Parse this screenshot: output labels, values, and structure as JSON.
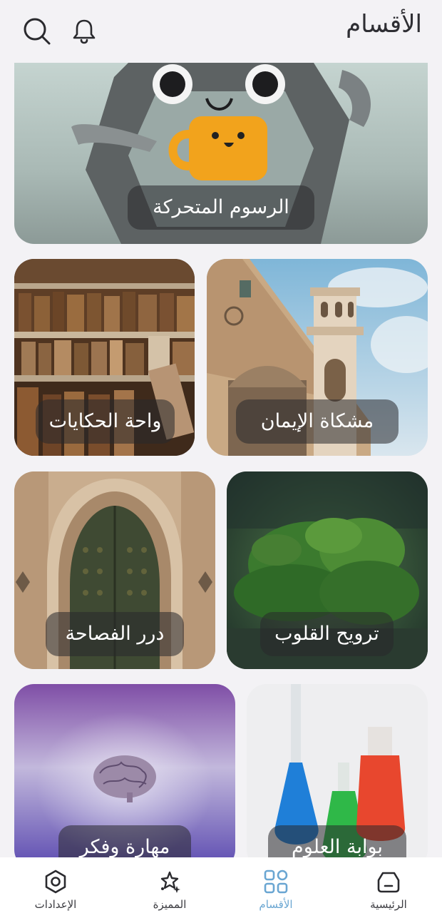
{
  "header": {
    "title": "الأقسام",
    "icons": [
      "search-icon",
      "bell-icon"
    ]
  },
  "categories": [
    {
      "name": "الرسوم المتحركة"
    },
    {
      "name": "مشكاة الإيمان"
    },
    {
      "name": "واحة الحكايات"
    },
    {
      "name": "ترويح القلوب"
    },
    {
      "name": "درر الفصاحة"
    },
    {
      "name": "بوابة العلوم"
    },
    {
      "name": "مهارة وفكر"
    }
  ],
  "bottom_nav": {
    "items": [
      {
        "label": "الرئيسية",
        "icon": "home-icon",
        "active": false
      },
      {
        "label": "الأقسام",
        "icon": "grid-icon",
        "active": true
      },
      {
        "label": "المميزة",
        "icon": "sparkle-icon",
        "active": false
      },
      {
        "label": "الإعدادات",
        "icon": "settings-icon",
        "active": false
      }
    ]
  },
  "colors": {
    "background": "#f3f2f5",
    "accent": "#6aa6d2",
    "text": "#2e2e33",
    "label_overlay": "rgba(40,40,44,0.55)"
  }
}
